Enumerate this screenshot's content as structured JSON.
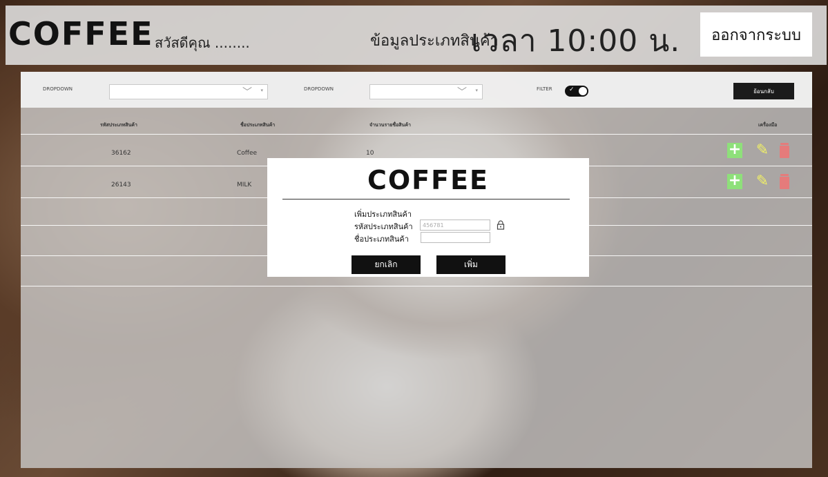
{
  "header": {
    "logo": "COFFEE",
    "greeting": "สวัสดีคุณ ........",
    "page_info": "ข้อมูลประเภทสินค้า",
    "time": "เวลา 10:00 น.",
    "logout_label": "ออกจากระบบ"
  },
  "filter_bar": {
    "dropdown1_label": "DROPDOWN",
    "dropdown2_label": "DROPDOWN",
    "filter_label": "FILTER",
    "filter_checked": true,
    "back_label": "ย้อนกลับ"
  },
  "table": {
    "columns": [
      "รหัสประเภทสินค้า",
      "ชื่อประเภทสินค้า",
      "จำนวนรายชื่อสินค้า",
      "เครื่องมือ"
    ],
    "rows": [
      {
        "code": "36162",
        "name": "Coffee",
        "count": "10"
      },
      {
        "code": "26143",
        "name": "MILK",
        "count": ""
      }
    ]
  },
  "modal": {
    "logo": "COFFEE",
    "heading": "เพิ่มประเภทสินค้า",
    "code_label": "รหัสประเภทสินค้า",
    "code_value": "456781",
    "name_label": "ชื่อประเภทสินค้า",
    "name_value": "",
    "cancel_label": "ยกเลิก",
    "add_label": "เพิ่ม"
  },
  "colors": {
    "add": "#8ee07a",
    "edit": "#f1f066",
    "delete": "#e57b7b",
    "dark": "#111111"
  }
}
